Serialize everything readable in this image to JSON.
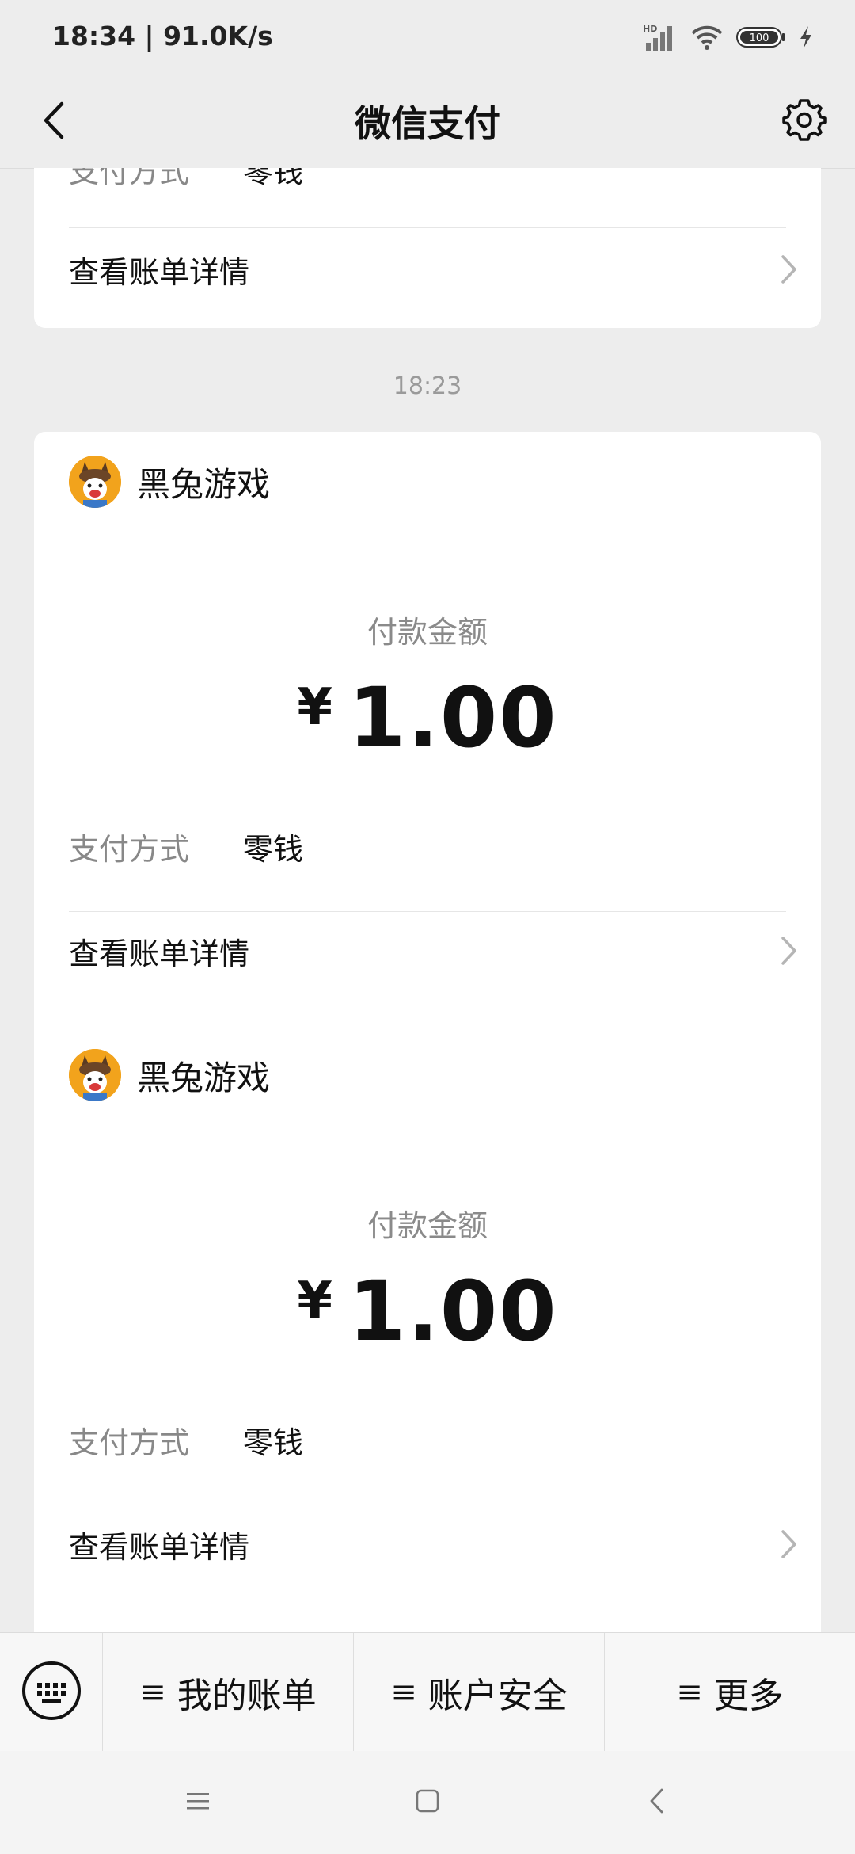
{
  "status_bar": {
    "time_speed": "18:34 | 91.0K/s",
    "network": "HD",
    "battery": "100"
  },
  "header": {
    "title": "微信支付",
    "back_icon": "chevron-left-icon",
    "settings_icon": "gear-icon"
  },
  "feed": {
    "partial_card": {
      "payment_method_label": "支付方式",
      "payment_method_value": "零钱",
      "detail_link": "查看账单详情"
    },
    "time_divider": "18:23",
    "cards": [
      {
        "merchant": "黑兔游戏",
        "amount_label": "付款金额",
        "currency": "¥",
        "amount": "1.00",
        "payment_method_label": "支付方式",
        "payment_method_value": "零钱",
        "detail_link": "查看账单详情"
      },
      {
        "merchant": "黑兔游戏",
        "amount_label": "付款金额",
        "currency": "¥",
        "amount": "1.00",
        "payment_method_label": "支付方式",
        "payment_method_value": "零钱",
        "detail_link": "查看账单详情"
      }
    ]
  },
  "bottom_menu": {
    "keyboard_icon": "keyboard-icon",
    "items": [
      {
        "icon": "≡",
        "label": "我的账单"
      },
      {
        "icon": "≡",
        "label": "账户安全"
      },
      {
        "icon": "≡",
        "label": "更多"
      }
    ]
  },
  "colors": {
    "background": "#ededed",
    "card": "#ffffff",
    "muted_text": "#888888",
    "avatar": "#f2a31c"
  }
}
